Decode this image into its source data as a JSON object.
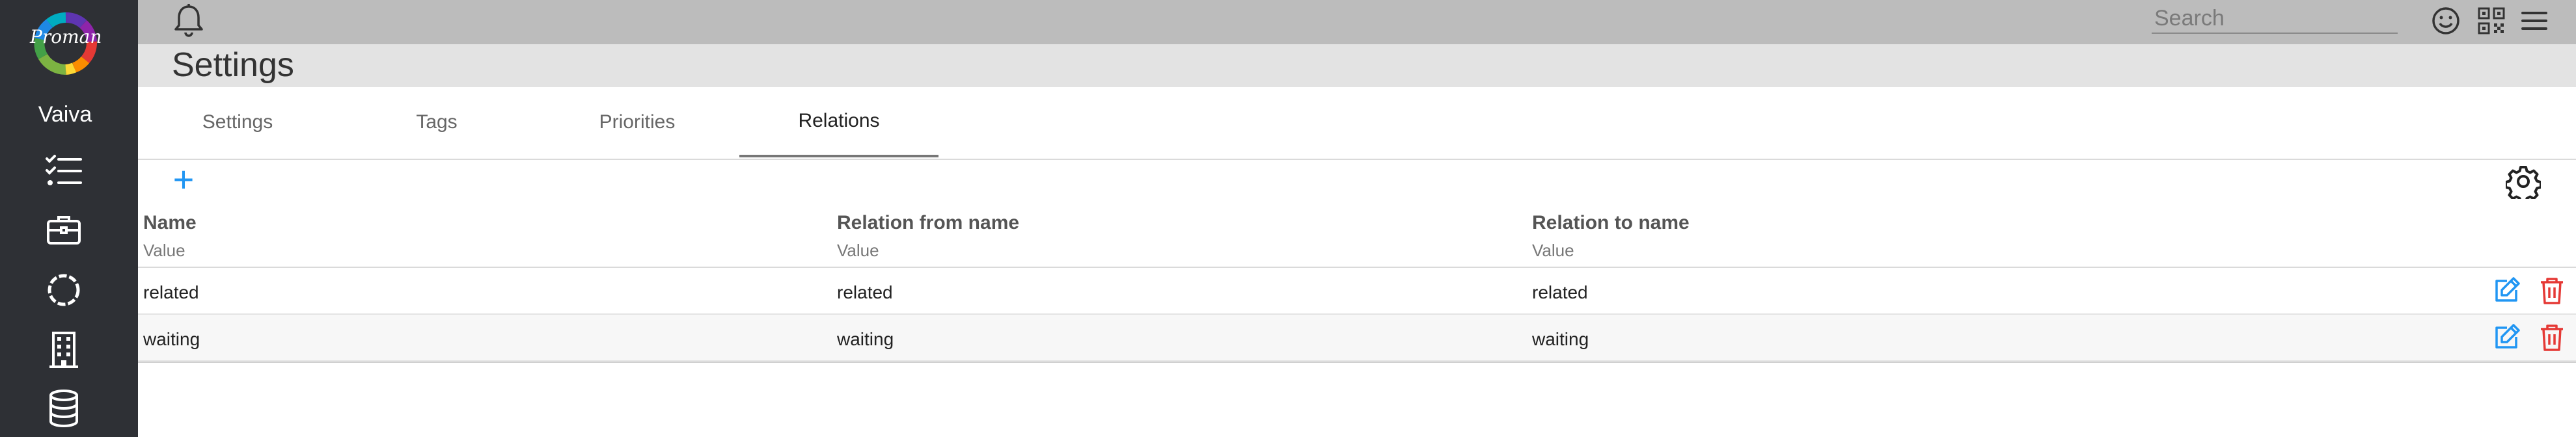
{
  "app": {
    "logo_text": "Proman",
    "user_name": "Vaiva",
    "logo_colors": [
      "#e53935",
      "#fb8c00",
      "#fdd835",
      "#7cb342",
      "#43a047",
      "#1e88e5",
      "#5e35b1",
      "#8e24aa"
    ]
  },
  "sidebar": {
    "items": [
      {
        "icon": "checklist-icon"
      },
      {
        "icon": "briefcase-icon"
      },
      {
        "icon": "dashed-circle-icon"
      },
      {
        "icon": "building-icon"
      },
      {
        "icon": "database-icon"
      }
    ]
  },
  "topbar": {
    "search_placeholder": "Search",
    "icons": [
      "bell-icon",
      "smiley-icon",
      "qr-code-icon",
      "hamburger-menu-icon"
    ]
  },
  "page": {
    "title": "Settings"
  },
  "tabs": [
    {
      "label": "Settings",
      "active": false
    },
    {
      "label": "Tags",
      "active": false
    },
    {
      "label": "Priorities",
      "active": false
    },
    {
      "label": "Relations",
      "active": true
    }
  ],
  "table": {
    "add_label": "+",
    "columns": [
      {
        "header": "Name",
        "filter_placeholder": "Value"
      },
      {
        "header": "Relation from name",
        "filter_placeholder": "Value"
      },
      {
        "header": "Relation to name",
        "filter_placeholder": "Value"
      }
    ],
    "rows": [
      {
        "name": "related",
        "from": "related",
        "to": "related"
      },
      {
        "name": "waiting",
        "from": "waiting",
        "to": "waiting"
      }
    ]
  },
  "colors": {
    "sidebar_bg": "#2e3035",
    "topbar_bg": "#bcbcbc",
    "titlebar_bg": "#e3e3e3",
    "accent_blue": "#2196f3",
    "delete_red": "#e53935"
  }
}
